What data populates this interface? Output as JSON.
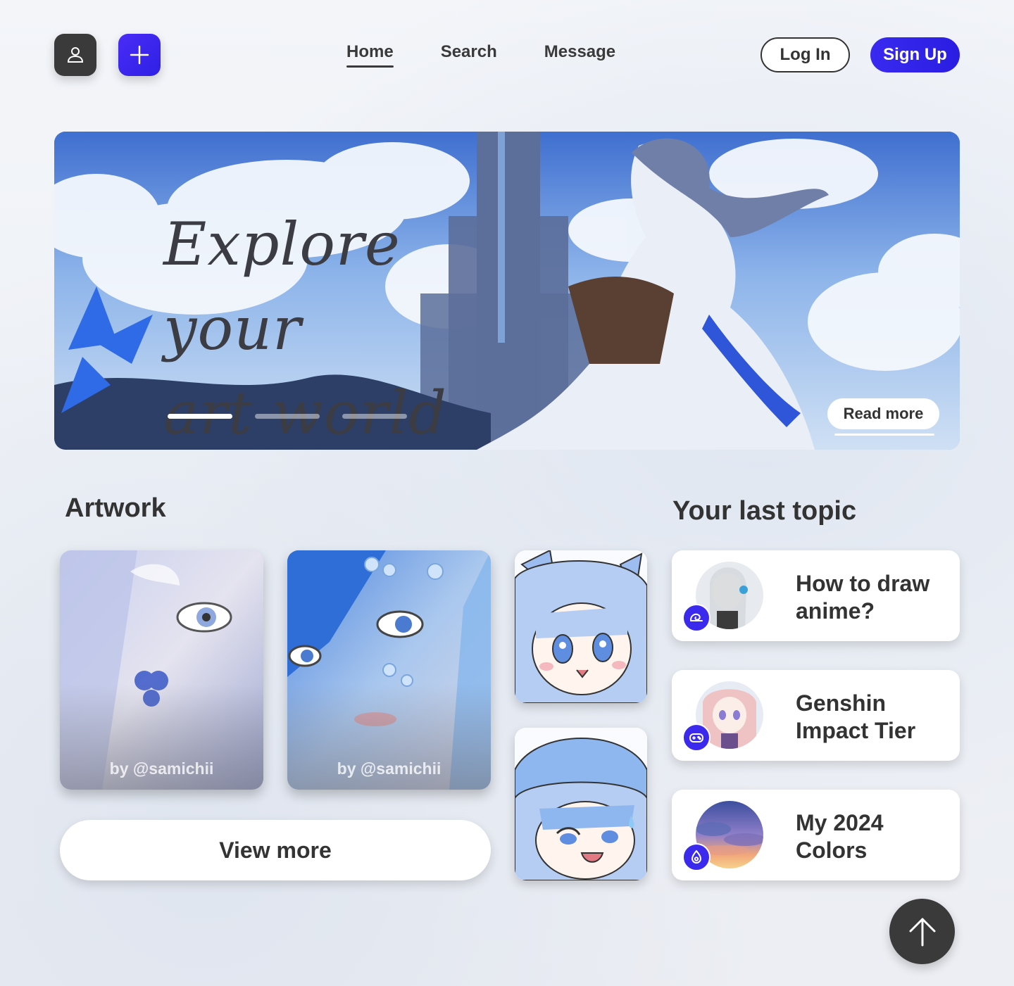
{
  "header": {
    "nav": [
      {
        "label": "Home",
        "active": true
      },
      {
        "label": "Search",
        "active": false
      },
      {
        "label": "Message",
        "active": false
      }
    ],
    "login_label": "Log In",
    "signup_label": "Sign Up",
    "profile_icon": "user-icon",
    "add_icon": "plus-icon"
  },
  "hero": {
    "title_line1": "Explore your",
    "title_line2": "art world",
    "read_more_label": "Read more",
    "slides_total": 3,
    "active_slide": 1
  },
  "artwork": {
    "title": "Artwork",
    "cards": [
      {
        "caption": "by @samichii"
      },
      {
        "caption": "by @samichii"
      }
    ],
    "view_more_label": "View more"
  },
  "topics": {
    "title": "Your last topic",
    "items": [
      {
        "label": "How to draw anime?",
        "badge_icon": "snail-icon"
      },
      {
        "label": "Genshin Impact Tier",
        "badge_icon": "gamepad-icon"
      },
      {
        "label": "My 2024 Colors",
        "badge_icon": "droplet-icon"
      }
    ]
  },
  "scroll_top_icon": "arrow-up-icon",
  "colors": {
    "accent": "#3b2aed",
    "dark": "#3a3a3a",
    "text": "#333333"
  }
}
